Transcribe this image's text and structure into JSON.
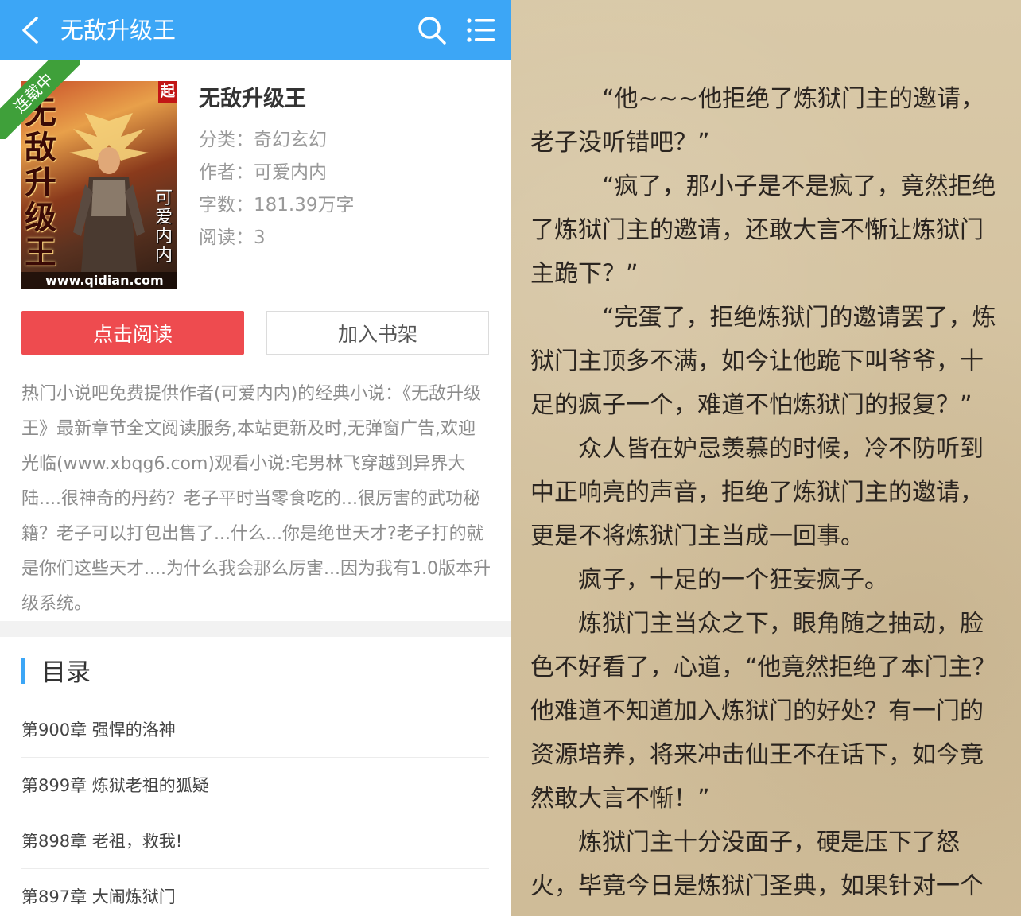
{
  "header": {
    "title": "无敌升级王"
  },
  "book": {
    "status_ribbon": "连载中",
    "cover": {
      "vertical_title": "无敌升级王",
      "vertical_author": "可爱内内",
      "corner_mark": "起",
      "site": "www.qidian.com"
    },
    "title": "无敌升级王",
    "meta": {
      "category": "分类：奇幻玄幻",
      "author": "作者：可爱内内",
      "words": "字数：181.39万字",
      "reads": "阅读：3"
    },
    "read_button": "点击阅读",
    "shelf_button": "加入书架",
    "description": "热门小说吧免费提供作者(可爱内内)的经典小说：《无敌升级王》最新章节全文阅读服务,本站更新及时,无弹窗广告,欢迎光临(www.xbqg6.com)观看小说:宅男林飞穿越到异界大陆....很神奇的丹药？老子平时当零食吃的...很厉害的武功秘籍？老子可以打包出售了...什么...你是绝世天才?老子打的就是你们这些天才....为什么我会那么厉害...因为我有1.0版本升级系统。"
  },
  "toc": {
    "title": "目录",
    "chapters": [
      "第900章 强悍的洛神",
      "第899章 炼狱老祖的狐疑",
      "第898章 老祖，救我!",
      "第897章 大闹炼狱门"
    ]
  },
  "reader": {
    "paragraphs": [
      "“他~~~他拒绝了炼狱门主的邀请，老子没听错吧？”",
      "“疯了，那小子是不是疯了，竟然拒绝了炼狱门主的邀请，还敢大言不惭让炼狱门主跪下？”",
      "“完蛋了，拒绝炼狱门的邀请罢了，炼狱门主顶多不满，如今让他跪下叫爷爷，十足的疯子一个，难道不怕炼狱门的报复？”",
      "众人皆在妒忌羡慕的时候，冷不防听到中正响亮的声音，拒绝了炼狱门主的邀请，更是不将炼狱门主当成一回事。",
      "疯子，十足的一个狂妄疯子。",
      "炼狱门主当众之下，眼角随之抽动，脸色不好看了，心道，“他竟然拒绝了本门主？他难道不知道加入炼狱门的好处？有一门的资源培养，将来冲击仙王不在话下，如今竟然敢大言不惭！”",
      "炼狱门主十分没面子，硬是压下了怒火，毕竟今日是炼狱门圣典，如果针对一个"
    ]
  },
  "colors": {
    "header_blue": "#3ca6f6",
    "read_button_red": "#ee4b4f",
    "ribbon_green": "#3fa03a",
    "paper": "#d3c19e"
  }
}
